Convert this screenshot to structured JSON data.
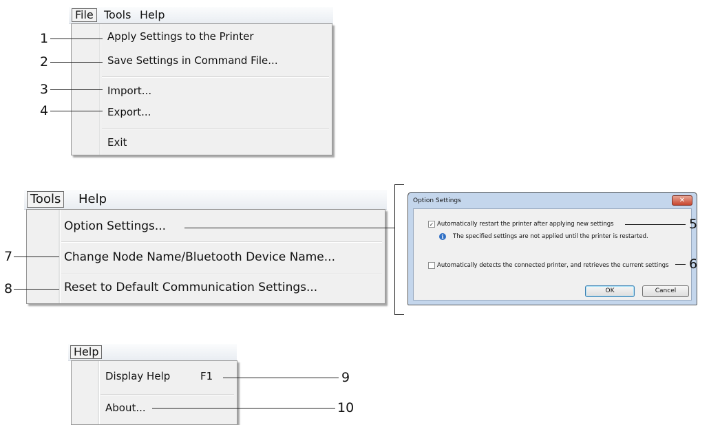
{
  "file_menu": {
    "menubar": [
      "File",
      "Tools",
      "Help"
    ],
    "items": [
      "Apply Settings to the Printer",
      "Save Settings in Command File...",
      "Import...",
      "Export...",
      "Exit"
    ],
    "callouts": [
      "1",
      "2",
      "3",
      "4"
    ]
  },
  "tools_menu": {
    "menubar": [
      "Tools",
      "Help"
    ],
    "items": [
      "Option Settings...",
      "Change Node Name/Bluetooth Device Name...",
      "Reset to Default Communication Settings..."
    ],
    "callouts": [
      "7",
      "8"
    ]
  },
  "help_menu": {
    "menubar": [
      "Help"
    ],
    "items": [
      {
        "label": "Display Help",
        "shortcut": "F1"
      },
      {
        "label": "About..."
      }
    ],
    "callouts": [
      "9",
      "10"
    ]
  },
  "option_dialog": {
    "title": "Option Settings",
    "close_glyph": "✕",
    "option1": {
      "label": "Automatically restart the printer after applying new settings",
      "checked": true
    },
    "info_text": "The specified settings are not applied until the printer is restarted.",
    "option2": {
      "label": "Automatically detects the connected printer, and retrieves the current settings",
      "checked": false
    },
    "ok_label": "OK",
    "cancel_label": "Cancel",
    "check_glyph": "✓",
    "info_glyph": "i",
    "callouts": [
      "5",
      "6"
    ]
  }
}
